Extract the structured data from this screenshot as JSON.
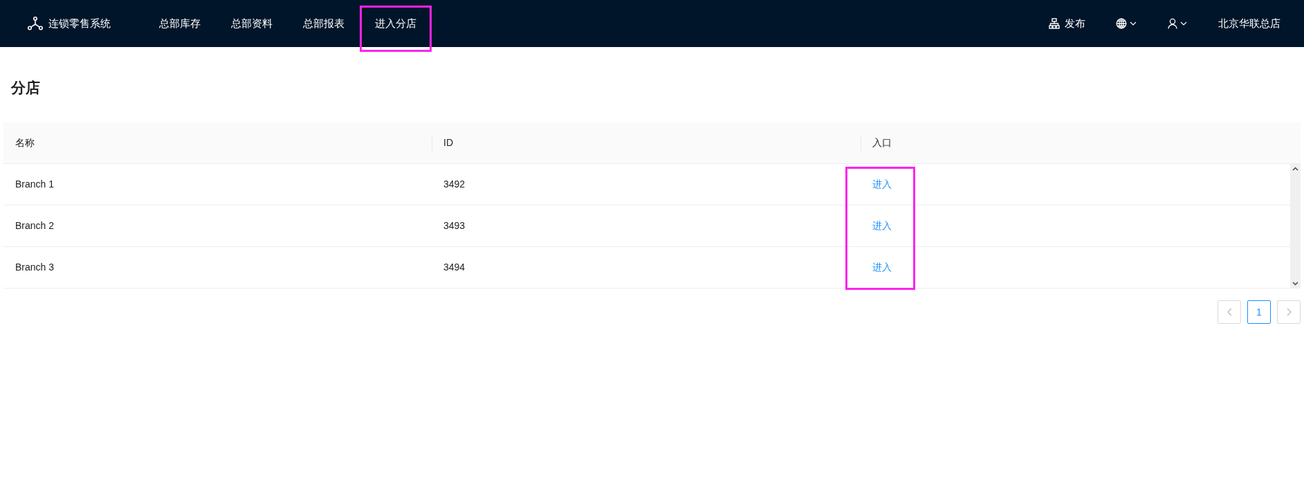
{
  "header": {
    "app_name": "连锁零售系统",
    "nav": [
      {
        "label": "总部库存",
        "highlighted": false
      },
      {
        "label": "总部资料",
        "highlighted": false
      },
      {
        "label": "总部报表",
        "highlighted": false
      },
      {
        "label": "进入分店",
        "highlighted": true
      }
    ],
    "publish": "发布",
    "store": "北京华联总店"
  },
  "page_title": "分店",
  "table": {
    "columns": [
      {
        "label": "名称"
      },
      {
        "label": "ID"
      },
      {
        "label": "入口"
      }
    ],
    "entry_links_highlighted": true,
    "rows": [
      {
        "name": "Branch 1",
        "id": "3492",
        "entry": "进入"
      },
      {
        "name": "Branch 2",
        "id": "3493",
        "entry": "进入"
      },
      {
        "name": "Branch 3",
        "id": "3494",
        "entry": "进入"
      }
    ]
  },
  "pagination": {
    "pages": [
      {
        "label": "1",
        "selected": true
      }
    ]
  }
}
